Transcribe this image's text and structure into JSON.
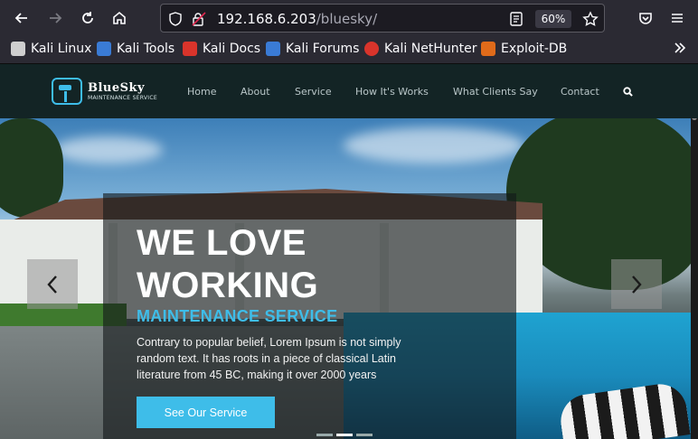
{
  "browser": {
    "url_host": "192.168.6.203",
    "url_path": "/bluesky/",
    "zoom": "60%"
  },
  "bookmarks": [
    {
      "label": "Kali Linux",
      "icon": "kali-dragon-icon",
      "color": "#cfcfcf"
    },
    {
      "label": "Kali Tools",
      "icon": "kali-tools-icon",
      "color": "#3a7bd5"
    },
    {
      "label": "Kali Docs",
      "icon": "kali-docs-icon",
      "color": "#d9342b"
    },
    {
      "label": "Kali Forums",
      "icon": "kali-forums-icon",
      "color": "#3a7bd5"
    },
    {
      "label": "Kali NetHunter",
      "icon": "nethunter-icon",
      "color": "#d9342b"
    },
    {
      "label": "Exploit-DB",
      "icon": "exploit-db-icon",
      "color": "#e06b1a"
    }
  ],
  "site": {
    "brand": "BlueSky",
    "brand_sub": "MAINTENANCE SERVICE",
    "accent": "#3ebde9",
    "nav": [
      "Home",
      "About",
      "Service",
      "How It's Works",
      "What Clients Say",
      "Contact"
    ]
  },
  "hero": {
    "title_line1": "WE LOVE",
    "title_line2": "WORKING",
    "subtitle": "MAINTENANCE SERVICE",
    "description": "Contrary to popular belief, Lorem Ipsum is not simply random text. It has roots in a piece of classical Latin literature from 45 BC, making it over 2000 years",
    "cta": "See Our Service"
  }
}
